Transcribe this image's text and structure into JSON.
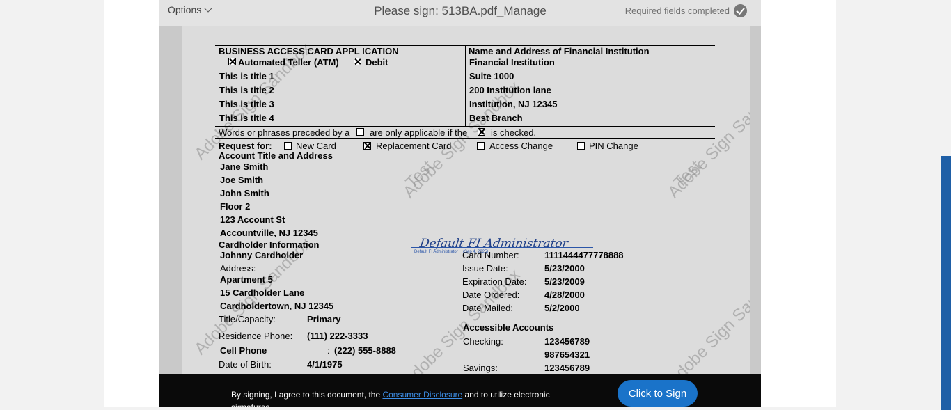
{
  "header": {
    "options_label": "Options",
    "title": "Please sign: 513BA.pdf_Manage",
    "status": "Required fields completed"
  },
  "form": {
    "app_title": "BUSINESS ACCESS CARD APPL ICATION",
    "atm_label": "Automated Teller (ATM)",
    "debit_label": "Debit",
    "titles": [
      "This is title 1",
      "This is title 2",
      "This is title 3",
      "This is title 4"
    ],
    "fi_header": "Name and Address of Financial Institution",
    "fi_lines": [
      "Financial Institution",
      "Suite 1000",
      "200 Institution lane",
      "Institution, NJ 12345",
      "Best Branch"
    ],
    "note_part1": "Words or phrases preceded by a",
    "note_part2": "are only applicable if the",
    "note_part3": "is checked.",
    "request_label": "Request for:",
    "request_options": [
      "New Card",
      "Replacement Card",
      "Access Change",
      "PIN Change"
    ],
    "account_header": "Account Title and Address",
    "account_lines": [
      "Jane Smith",
      "Joe Smith",
      "John Smith",
      "Floor 2",
      "123 Account St",
      "Accountville, NJ 12345"
    ],
    "cardholder_header": "Cardholder Information",
    "cardholder_name": "Johnny Cardholder",
    "address_label": "Address:",
    "address_lines": [
      "Apartment 5",
      "15 Cardholder Lane",
      "Cardholdertown, NJ 12345"
    ],
    "title_capacity_label": "Title/Capacity:",
    "title_capacity_value": "Primary",
    "residence_phone_label": "Residence Phone:",
    "residence_phone_value": "(111) 222-3333",
    "cell_phone_label": "Cell Phone",
    "cell_phone_colon": ":",
    "cell_phone_value": "(222) 555-8888",
    "dob_label": "Date of Birth:",
    "dob_value": "4/1/1975",
    "card_number_label": "Card Number:",
    "card_number_value": "1111444477778888",
    "issue_date_label": "Issue Date:",
    "issue_date_value": "5/23/2000",
    "expiration_label": "Expiration Date:",
    "expiration_value": "5/23/2009",
    "ordered_label": "Date Ordered:",
    "ordered_value": "4/28/2000",
    "mailed_label": "Date Mailed:",
    "mailed_value": "5/2/2000",
    "accessible_header": "Accessible Accounts",
    "checking_label": "Checking:",
    "checking_values": [
      "123456789",
      "987654321"
    ],
    "savings_label": "Savings:",
    "savings_value": "123456789"
  },
  "signature": {
    "name": "Default FI Administrator",
    "meta_name": "Default FI Administrator",
    "meta_date": "(Sep 4, 2025)"
  },
  "watermark": {
    "line1": "Adobe Sign Sandbox",
    "line2": "Test"
  },
  "footer": {
    "consent_prefix": "By signing, I agree to this document, the",
    "consent_link": "Consumer Disclosure",
    "consent_suffix": "and to utilize electronic signatures.",
    "sign_button": "Click to Sign"
  },
  "colors": {
    "accent": "#1a73c9",
    "link": "#3d8ee6",
    "side_bar": "#1f5fa6"
  }
}
